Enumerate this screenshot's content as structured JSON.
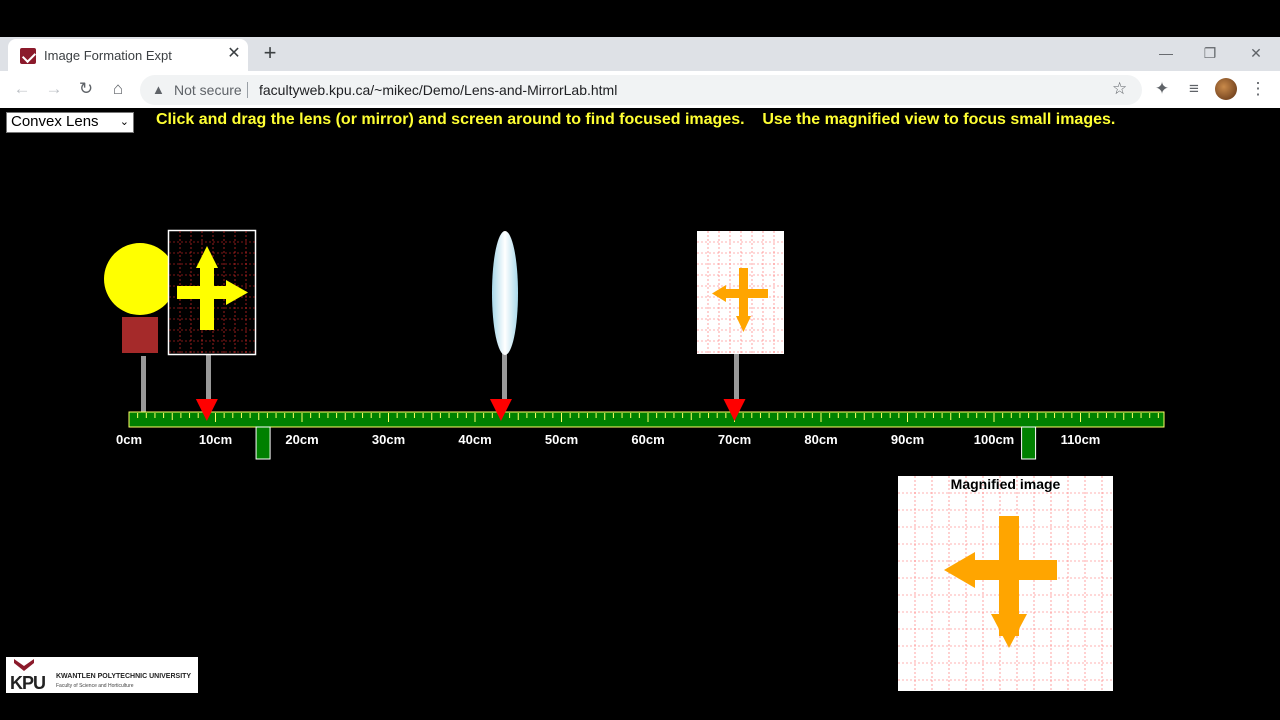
{
  "browser": {
    "tab_title": "Image Formation Expt",
    "not_secure": "Not secure",
    "url": "facultyweb.kpu.ca/~mikec/Demo/Lens-and-MirrorLab.html"
  },
  "controls": {
    "mode_selected": "Convex Lens",
    "instructions": "Click and drag the lens (or mirror) and screen around to find focused images.    Use the magnified view to focus small images."
  },
  "bench": {
    "unit": "cm",
    "tick_labels": [
      "0cm",
      "10cm",
      "20cm",
      "30cm",
      "40cm",
      "50cm",
      "60cm",
      "70cm",
      "80cm",
      "90cm",
      "100cm",
      "110cm"
    ],
    "object_position_cm": 9,
    "lens_position_cm": 43,
    "screen_position_cm": 70,
    "focal_markers_cm": [
      15.5,
      104
    ]
  },
  "magnifier": {
    "title": "Magnified image"
  },
  "logo": {
    "short": "KPU",
    "name": "KWANTLEN POLYTECHNIC UNIVERSITY",
    "faculty": "Faculty of Science and Horticulture"
  },
  "colors": {
    "object_arrow": "#ffff00",
    "image_arrow": "#ffa500",
    "ruler": "#008000",
    "marker": "#ff0000",
    "bulb": "#ffff00",
    "bulb_base": "#a52a2a"
  }
}
